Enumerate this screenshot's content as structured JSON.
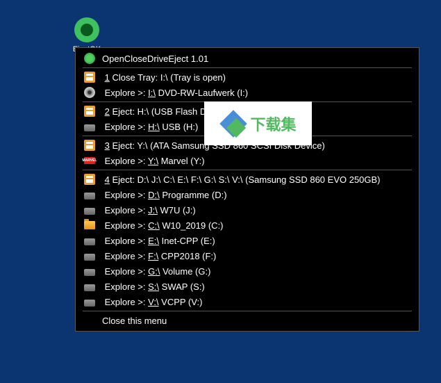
{
  "desktop": {
    "icon_label": "EjectOK"
  },
  "menu": {
    "title": "OpenCloseDriveEject 1.01",
    "sections": [
      {
        "eject": {
          "num": "1",
          "action": "Close Tray:",
          "drive": "I:\\",
          "desc": "(Tray is open)"
        },
        "explore": [
          {
            "icon": "disc",
            "drive": "I:\\",
            "label": "DVD-RW-Laufwerk (I:)"
          }
        ]
      },
      {
        "eject": {
          "num": "2",
          "action": "Eject:",
          "drive": "H:\\",
          "desc": "(USB Flash Disk)"
        },
        "explore": [
          {
            "icon": "drive",
            "drive": "H:\\",
            "label": "USB (H:)"
          }
        ]
      },
      {
        "eject": {
          "num": "3",
          "action": "Eject:",
          "drive": "Y:\\",
          "desc": "(ATA Samsung SSD 860 SCSI Disk Device)"
        },
        "explore": [
          {
            "icon": "marvel",
            "drive": "Y:\\",
            "label": "Marvel (Y:)"
          }
        ]
      },
      {
        "eject": {
          "num": "4",
          "action": "Eject:",
          "drive": "D:\\ J:\\ C:\\ E:\\ F:\\ G:\\ S:\\ V:\\",
          "desc": "(Samsung SSD 860 EVO 250GB)"
        },
        "explore": [
          {
            "icon": "drive",
            "drive": "D:\\",
            "label": "Programme (D:)"
          },
          {
            "icon": "drive",
            "drive": "J:\\",
            "label": "W7U (J:)"
          },
          {
            "icon": "explorer",
            "drive": "C:\\",
            "label": "W10_2019 (C:)"
          },
          {
            "icon": "drive",
            "drive": "E:\\",
            "label": "Inet-CPP (E:)"
          },
          {
            "icon": "drive",
            "drive": "F:\\",
            "label": "CPP2018 (F:)"
          },
          {
            "icon": "drive",
            "drive": "G:\\",
            "label": "Volume (G:)"
          },
          {
            "icon": "drive",
            "drive": "S:\\",
            "label": "SWAP (S:)"
          },
          {
            "icon": "drive",
            "drive": "V:\\",
            "label": "VCPP (V:)"
          }
        ]
      }
    ],
    "close_label": "Close this menu"
  },
  "watermark": {
    "text": "下载集"
  }
}
